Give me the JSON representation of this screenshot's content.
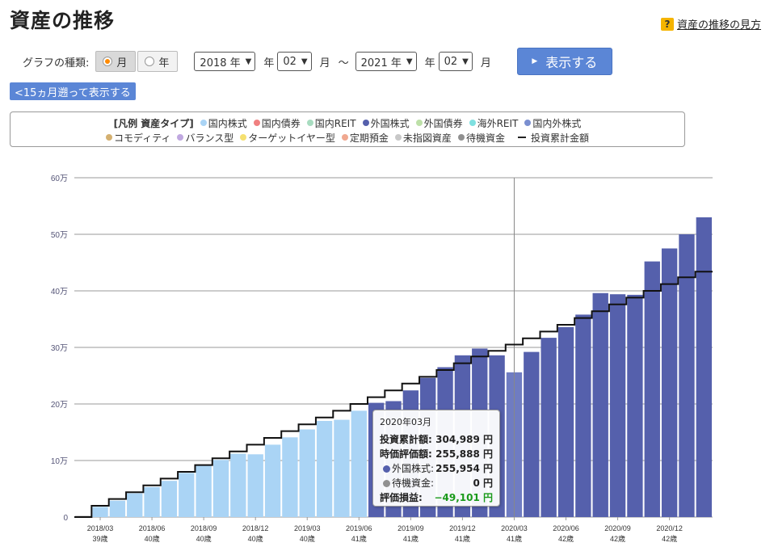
{
  "page": {
    "title": "資産の推移",
    "help_link": "資産の推移の見方",
    "help_icon": "?"
  },
  "controls": {
    "graph_type_label": "グラフの種類:",
    "monthly_label": "月",
    "yearly_label": "年",
    "start_year": "2018 年",
    "start_month": "02",
    "end_year": "2021 年",
    "end_month": "02",
    "year_unit": "年",
    "month_unit": "月",
    "tilde": "～",
    "show_button": "表示する",
    "back_button": "<15ヵ月遡って表示する"
  },
  "legend": {
    "title": "[凡例 資産タイプ]",
    "items": [
      {
        "label": "国内株式",
        "color": "#aad4f5"
      },
      {
        "label": "国内債券",
        "color": "#f08080"
      },
      {
        "label": "国内REIT",
        "color": "#a8dcc0"
      },
      {
        "label": "外国株式",
        "color": "#5560ac"
      },
      {
        "label": "外国債券",
        "color": "#bde0a8"
      },
      {
        "label": "海外REIT",
        "color": "#7fe0e0"
      },
      {
        "label": "国内外株式",
        "color": "#7a8fd0"
      },
      {
        "label": "コモディティ",
        "color": "#d4b070"
      },
      {
        "label": "バランス型",
        "color": "#c0a8e0"
      },
      {
        "label": "ターゲットイヤー型",
        "color": "#f5e070"
      },
      {
        "label": "定期預金",
        "color": "#f0a890"
      },
      {
        "label": "未指図資産",
        "color": "#c8c8c8"
      },
      {
        "label": "待機資金",
        "color": "#909090"
      }
    ],
    "line_label": "投資累計金額"
  },
  "chart_data": {
    "type": "bar",
    "ylim": [
      0,
      600000
    ],
    "y_ticks": [
      {
        "value": 0,
        "label": "0"
      },
      {
        "value": 100000,
        "label": "10万"
      },
      {
        "value": 200000,
        "label": "20万"
      },
      {
        "value": 300000,
        "label": "30万"
      },
      {
        "value": 400000,
        "label": "40万"
      },
      {
        "value": 500000,
        "label": "50万"
      },
      {
        "value": 600000,
        "label": "60万"
      }
    ],
    "categories": [
      "2018/02",
      "2018/03",
      "2018/04",
      "2018/05",
      "2018/06",
      "2018/07",
      "2018/08",
      "2018/09",
      "2018/10",
      "2018/11",
      "2018/12",
      "2019/01",
      "2019/02",
      "2019/03",
      "2019/04",
      "2019/05",
      "2019/06",
      "2019/07",
      "2019/08",
      "2019/09",
      "2019/10",
      "2019/11",
      "2019/12",
      "2020/01",
      "2020/02",
      "2020/03",
      "2020/04",
      "2020/05",
      "2020/06",
      "2020/07",
      "2020/08",
      "2020/09",
      "2020/10",
      "2020/11",
      "2020/12",
      "2021/01",
      "2021/02"
    ],
    "x_labels": [
      {
        "index": 1,
        "date": "2018/03",
        "age": "39歳"
      },
      {
        "index": 4,
        "date": "2018/06",
        "age": "40歳"
      },
      {
        "index": 7,
        "date": "2018/09",
        "age": "40歳"
      },
      {
        "index": 10,
        "date": "2018/12",
        "age": "40歳"
      },
      {
        "index": 13,
        "date": "2019/03",
        "age": "40歳"
      },
      {
        "index": 16,
        "date": "2019/06",
        "age": "41歳"
      },
      {
        "index": 19,
        "date": "2019/09",
        "age": "41歳"
      },
      {
        "index": 22,
        "date": "2019/12",
        "age": "41歳"
      },
      {
        "index": 25,
        "date": "2020/03",
        "age": "41歳"
      },
      {
        "index": 28,
        "date": "2020/06",
        "age": "42歳"
      },
      {
        "index": 31,
        "date": "2020/09",
        "age": "42歳"
      },
      {
        "index": 34,
        "date": "2020/12",
        "age": "42歳"
      }
    ],
    "series": [
      {
        "name": "国内株式",
        "color": "#aad4f5",
        "values": [
          0,
          18000,
          29000,
          42000,
          53000,
          64000,
          78000,
          92000,
          101000,
          112000,
          111000,
          128000,
          141000,
          155000,
          170000,
          172000,
          188000,
          0,
          0,
          0,
          0,
          0,
          0,
          0,
          0,
          0,
          0,
          0,
          0,
          0,
          0,
          0,
          0,
          0,
          0,
          0,
          0
        ]
      },
      {
        "name": "外国株式",
        "color": "#5560ac",
        "values": [
          0,
          0,
          0,
          0,
          0,
          0,
          0,
          0,
          0,
          0,
          0,
          0,
          0,
          0,
          0,
          0,
          0,
          202000,
          205000,
          224000,
          246000,
          265000,
          286000,
          298000,
          286000,
          255954,
          292000,
          317000,
          336000,
          358000,
          396000,
          394000,
          393000,
          452000,
          475000,
          500000,
          530000
        ]
      },
      {
        "name": "待機資金",
        "color": "#909090",
        "values": [
          2000,
          0,
          0,
          0,
          0,
          0,
          0,
          0,
          0,
          0,
          0,
          0,
          0,
          0,
          0,
          0,
          0,
          0,
          0,
          0,
          0,
          0,
          0,
          0,
          0,
          0,
          0,
          0,
          0,
          0,
          0,
          0,
          0,
          0,
          0,
          0,
          0
        ]
      }
    ],
    "highlight_index": 25,
    "highlight_color": "#6f7cc2",
    "line": {
      "name": "投資累計金額",
      "values": [
        0,
        20000,
        32000,
        44000,
        56000,
        68000,
        80000,
        92000,
        104000,
        116000,
        128000,
        140000,
        152000,
        164000,
        176000,
        188000,
        200000,
        212000,
        224000,
        236000,
        248000,
        260000,
        272000,
        284000,
        294000,
        304989,
        316000,
        328000,
        340000,
        352000,
        364000,
        376000,
        388000,
        400000,
        412000,
        424000,
        434000
      ]
    }
  },
  "tooltip": {
    "date": "2020年03月",
    "invested_label": "投資累計額:",
    "invested_value": "304,989 円",
    "market_label": "時価評価額:",
    "market_value": "255,888 円",
    "foreign_label": "外国株式:",
    "foreign_value": "255,954 円",
    "foreign_color": "#5560ac",
    "cash_label": "待機資金:",
    "cash_value": "0 円",
    "cash_color": "#909090",
    "pl_label": "評価損益:",
    "pl_value": "−49,101 円"
  }
}
